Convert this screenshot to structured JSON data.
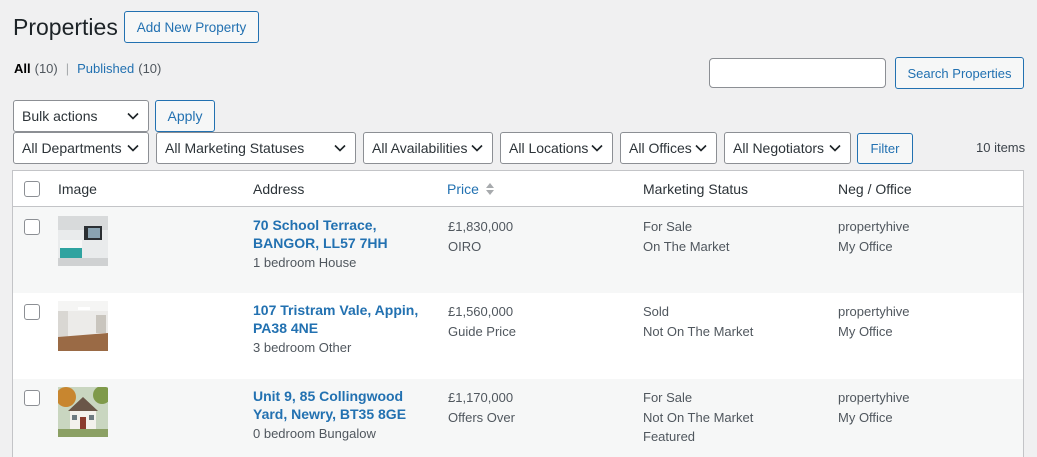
{
  "page": {
    "title": "Properties",
    "add_new_label": "Add New Property"
  },
  "views": {
    "all_label": "All",
    "all_count": "(10)",
    "separator": "|",
    "published_label": "Published",
    "published_count": "(10)"
  },
  "search": {
    "value": "",
    "button_label": "Search Properties"
  },
  "bulk": {
    "selected": "Bulk actions",
    "apply_label": "Apply"
  },
  "filters": {
    "departments": "All Departments",
    "marketing_statuses": "All Marketing Statuses",
    "availabilities": "All Availabilities",
    "locations": "All Locations",
    "offices": "All Offices",
    "negotiators": "All Negotiators",
    "filter_label": "Filter"
  },
  "items_count": "10 items",
  "table": {
    "columns": {
      "image": "Image",
      "address": "Address",
      "price": "Price",
      "marketing_status": "Marketing Status",
      "neg_office": "Neg / Office"
    },
    "rows": [
      {
        "address_line1": "70 School Terrace,",
        "address_line2": "BANGOR, LL57 7HH",
        "summary": "1 bedroom House",
        "price": "£1,830,000",
        "price_qualifier": "OIRO",
        "status_1": "For Sale",
        "status_2": "On The Market",
        "status_3": "",
        "negotiator": "propertyhive",
        "office": "My Office"
      },
      {
        "address_line1": "107 Tristram Vale, Appin,",
        "address_line2": "PA38 4NE",
        "summary": "3 bedroom Other",
        "price": "£1,560,000",
        "price_qualifier": "Guide Price",
        "status_1": "Sold",
        "status_2": "Not On The Market",
        "status_3": "",
        "negotiator": "propertyhive",
        "office": "My Office"
      },
      {
        "address_line1": "Unit 9, 85 Collingwood",
        "address_line2": "Yard, Newry, BT35 8GE",
        "summary": "0 bedroom Bungalow",
        "price": "£1,170,000",
        "price_qualifier": "Offers Over",
        "status_1": "For Sale",
        "status_2": "Not On The Market",
        "status_3": "Featured",
        "negotiator": "propertyhive",
        "office": "My Office"
      }
    ]
  },
  "colors": {
    "accent": "#2271b1",
    "background": "#f0f0f1",
    "border": "#8c8f94"
  }
}
